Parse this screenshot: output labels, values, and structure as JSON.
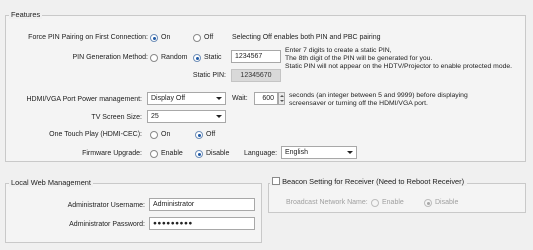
{
  "features": {
    "legend": "Features",
    "force_pin": {
      "label": "Force PIN Pairing on First Connection:",
      "opt_on": "On",
      "opt_off": "Off",
      "selected": "On",
      "hint": "Selecting Off enables both PIN and PBC pairing"
    },
    "pin_method": {
      "label": "PIN Generation Method:",
      "opt_random": "Random",
      "opt_static": "Static",
      "selected": "Static",
      "value": "1234567",
      "hint_lines": [
        "Enter 7 digits to create a static PIN,",
        "The 8th digit of the PIN will be generated for you.",
        "Static PIN will not appear on the HDTV/Projector to enable protected mode."
      ]
    },
    "static_pin": {
      "label": "Static PIN:",
      "value": "12345670"
    },
    "port_power": {
      "label": "HDMI/VGA Port Power management:",
      "selected": "Display Off",
      "wait_label": "Wait:",
      "wait_value": "600",
      "hint_lines": [
        "seconds (an integer between 5 and 9999) before displaying",
        "screensaver or turning off the HDMI/VGA port."
      ]
    },
    "tv_size": {
      "label": "TV Screen Size:",
      "selected": "25"
    },
    "one_touch": {
      "label": "One Touch Play (HDMI-CEC):",
      "opt_on": "On",
      "opt_off": "Off",
      "selected": "Off"
    },
    "firmware": {
      "label": "Firmware Upgrade:",
      "opt_enable": "Enable",
      "opt_disable": "Disable",
      "selected": "Disable",
      "language_label": "Language:",
      "language_selected": "English"
    }
  },
  "web_mgmt": {
    "legend": "Local Web Management",
    "username_label": "Administrator Username:",
    "username_value": "Administrator",
    "password_label": "Administrator Password:",
    "password_value": "●●●●●●●●●"
  },
  "beacon": {
    "legend": "Beacon Setting for Receiver (Need to Reboot Receiver)",
    "checked": false,
    "network_name_label": "Broadcast Network Name:",
    "opt_enable": "Enable",
    "opt_disable": "Disable",
    "selected": "Disable"
  }
}
